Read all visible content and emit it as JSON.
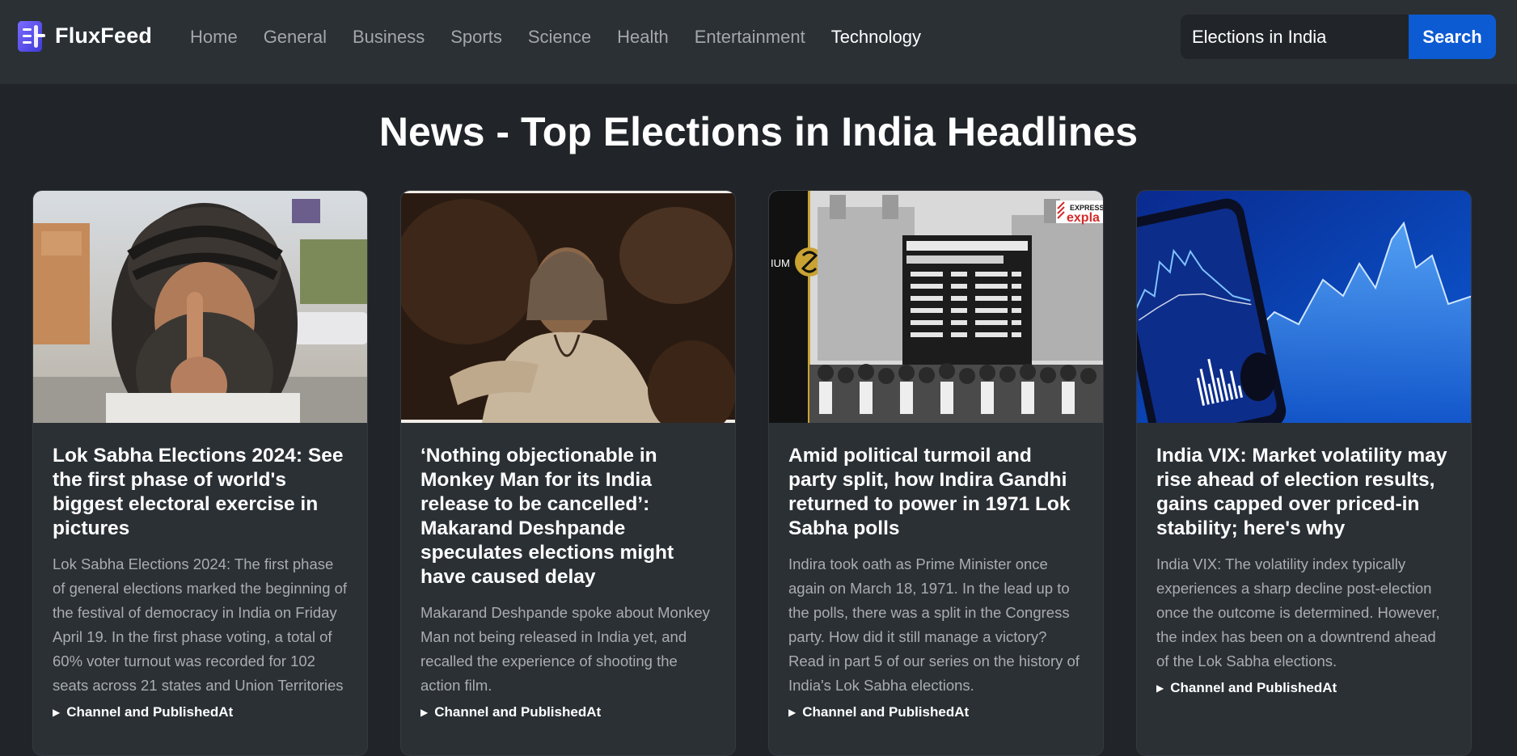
{
  "brand": {
    "name": "FluxFeed",
    "logo_icon": "document-lines-logo-icon",
    "accent": "#5a55f6"
  },
  "nav": {
    "links": [
      {
        "label": "Home",
        "active": false
      },
      {
        "label": "General",
        "active": false
      },
      {
        "label": "Business",
        "active": false
      },
      {
        "label": "Sports",
        "active": false
      },
      {
        "label": "Science",
        "active": false
      },
      {
        "label": "Health",
        "active": false
      },
      {
        "label": "Entertainment",
        "active": false
      },
      {
        "label": "Technology",
        "active": true
      }
    ]
  },
  "search": {
    "value": "Elections in India",
    "button_label": "Search",
    "button_color": "#0d5bd3"
  },
  "page": {
    "title": "News - Top Elections in India Headlines"
  },
  "articles": [
    {
      "image": "voter-showing-inked-finger-photo",
      "title": "Lok Sabha Elections 2024: See the first phase of world's biggest electoral exercise in pictures",
      "description": "Lok Sabha Elections 2024: The first phase of general elections marked the beginning of the festival of democracy in India on Friday April 19. In the first phase voting, a total of 60% voter turnout was recorded for 102 seats across 21 states and Union Territories",
      "meta_label": "Channel and PublishedAt"
    },
    {
      "image": "actor-film-still-photo",
      "title": "‘Nothing objectionable in Monkey Man for its India release to be cancelled’: Makarand Deshpande speculates elections might have caused delay",
      "description": "Makarand Deshpande spoke about Monkey Man not being released in India yet, and recalled the experience of shooting the action film.",
      "meta_label": "Channel and PublishedAt"
    },
    {
      "image": "historic-election-results-board-photo",
      "image_overlay_left": "IUM",
      "image_overlay_right": "EXPRESS expla",
      "title": "Amid political turmoil and party split, how Indira Gandhi returned to power in 1971 Lok Sabha polls",
      "description": "Indira took oath as Prime Minister once again on March 18, 1971. In the lead up to the polls, there was a split in the Congress party. How did it still manage a victory? Read in part 5 of our series on the history of India's Lok Sabha elections.",
      "meta_label": "Channel and PublishedAt"
    },
    {
      "image": "market-volatility-chart-phone-photo",
      "title": "India VIX: Market volatility may rise ahead of election results, gains capped over priced-in stability; here's why",
      "description": "India VIX: The volatility index typically experiences a sharp decline post-election once the outcome is determined. However, the index has been on a downtrend ahead of the Lok Sabha elections.",
      "meta_label": "Channel and PublishedAt"
    }
  ]
}
